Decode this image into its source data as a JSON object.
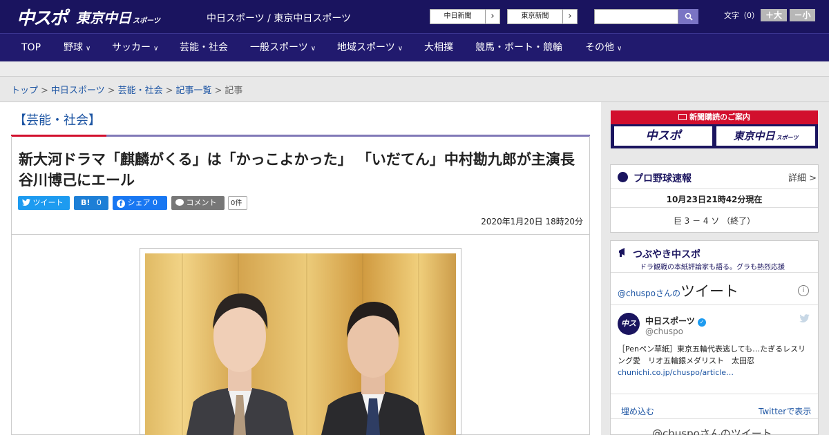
{
  "header": {
    "logo_chuspo": "中スポ",
    "logo_tokyo": "東京中日",
    "logo_tokyo_sub": "スポーツ",
    "site_name": "中日スポーツ / 東京中日スポーツ",
    "btn_chunichi": "中日新聞",
    "btn_tokyo": "東京新聞",
    "search_placeholder": "",
    "font_size_label": "文字（0）",
    "font_larger": "＋大",
    "font_smaller": "－小"
  },
  "nav": {
    "items": [
      {
        "label": "TOP"
      },
      {
        "label": "野球"
      },
      {
        "label": "サッカー"
      },
      {
        "label": "芸能・社会"
      },
      {
        "label": "一般スポーツ"
      },
      {
        "label": "地域スポーツ"
      },
      {
        "label": "大相撲"
      },
      {
        "label": "競馬・ボート・競輪"
      },
      {
        "label": "その他"
      }
    ]
  },
  "breadcrumb": {
    "items": [
      "トップ",
      "中日スポーツ",
      "芸能・社会",
      "記事一覧"
    ],
    "current": "記事",
    "separator": ">"
  },
  "article": {
    "category": "【芸能・社会】",
    "headline": "新大河ドラマ「麒麟がくる」は「かっこよかった」 「いだてん」中村勘九郎が主演長谷川博己にエール",
    "tweet": "ツイート",
    "hatena_icon": "B!",
    "hatena_count": "0",
    "share": "シェア 0",
    "comment": "コメント",
    "comment_count": "0件",
    "date": "2020年1月20日 18時20分"
  },
  "sidebar": {
    "subscription_title": "新聞購読のご案内",
    "sub_chuspo": "中スポ",
    "sub_tokyo": "東京中日",
    "sub_tokyo_small": "スポーツ",
    "baseball_title": "プロ野球速報",
    "baseball_more": "詳細 >",
    "baseball_time": "10月23日21時42分現在",
    "baseball_score": "巨 3 － 4 ソ （終了）",
    "tw_title": "つぶやき中スポ",
    "tw_subtitle": "ドラ観戦の本紙評論家も語る。グラも熱烈応援",
    "tw_header_user": "@chuspoさんの",
    "tw_header_word": "ツイート",
    "tw_avatar": "中スポ",
    "tw_name": "中日スポーツ",
    "tw_handle": "@chuspo",
    "tw_text": "［Penペン草紙］東京五輪代表逃しても…たぎるレスリング愛　リオ五輪銀メダリスト　太田忍",
    "tw_link": "chunichi.co.jp/chuspo/article…",
    "tw_embed": "埋め込む",
    "tw_view": "Twitterで表示",
    "tw_more": "@chuspoさんのツイート"
  },
  "colors": {
    "brand_navy": "#1a145f",
    "accent_red": "#d20f2d",
    "link_blue": "#1d55a3",
    "twitter_blue": "#1d9bf0",
    "facebook_blue": "#1877f2"
  }
}
